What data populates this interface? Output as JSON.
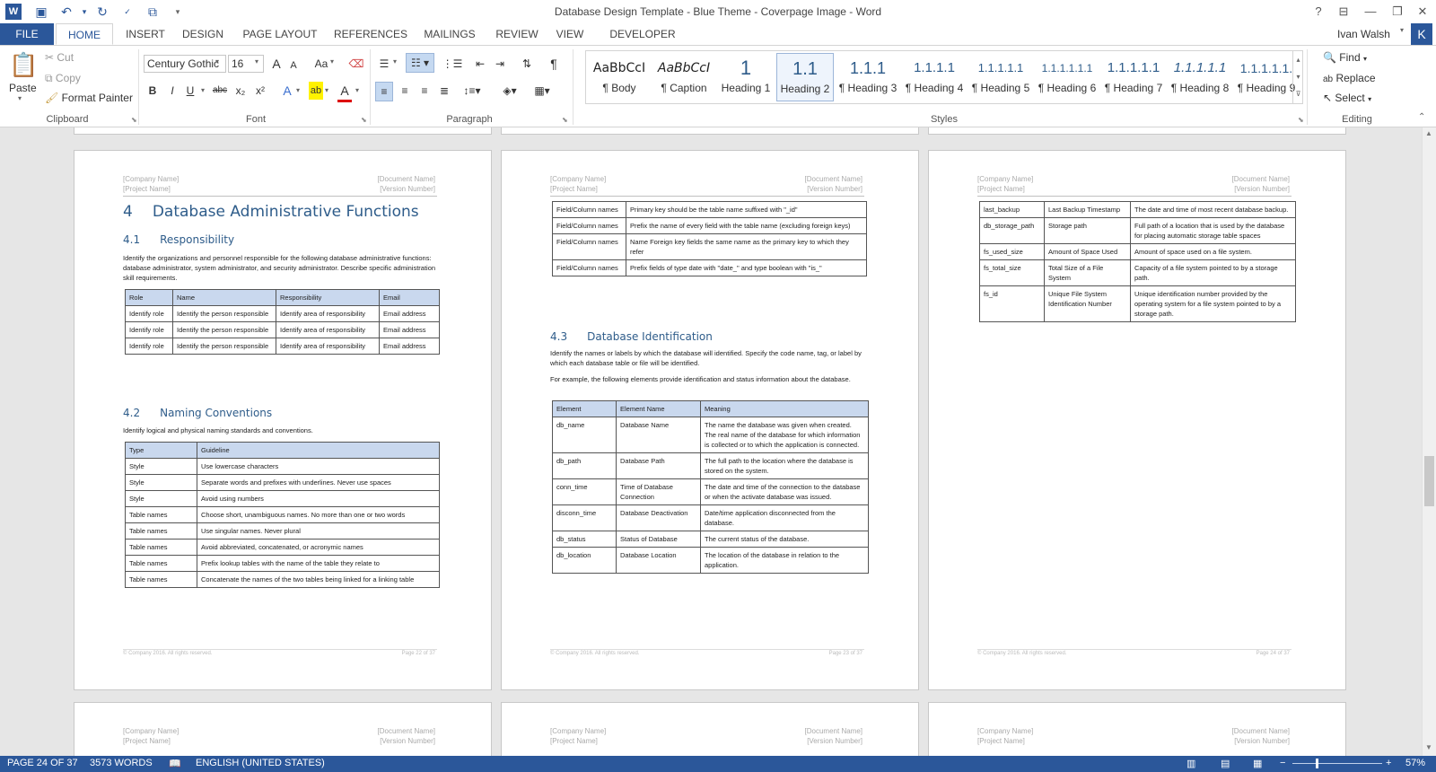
{
  "window": {
    "title": "Database Design Template - Blue Theme - Coverpage Image - Word",
    "help": "?"
  },
  "tabs": [
    "FILE",
    "HOME",
    "INSERT",
    "DESIGN",
    "PAGE LAYOUT",
    "REFERENCES",
    "MAILINGS",
    "REVIEW",
    "VIEW",
    "DEVELOPER"
  ],
  "user": {
    "name": "Ivan Walsh",
    "initial": "K"
  },
  "ribbon": {
    "clipboard": {
      "label": "Clipboard",
      "paste": "Paste",
      "cut": "Cut",
      "copy": "Copy",
      "format_painter": "Format Painter"
    },
    "font": {
      "label": "Font",
      "family": "Century Gothic",
      "size": "16",
      "bold": "B",
      "italic": "I",
      "underline": "U",
      "strike": "abc",
      "sub": "x₂",
      "sup": "x²",
      "case": "Aa",
      "grow": "A",
      "shrink": "A"
    },
    "paragraph": {
      "label": "Paragraph",
      "pilcrow": "¶"
    },
    "styles": {
      "label": "Styles",
      "items": [
        {
          "preview": "AaBbCcI",
          "name": "¶ Body"
        },
        {
          "preview": "AaBbCcI",
          "name": "¶ Caption"
        },
        {
          "preview": "1",
          "name": "Heading 1"
        },
        {
          "preview": "1.1",
          "name": "Heading 2"
        },
        {
          "preview": "1.1.1",
          "name": "¶ Heading 3"
        },
        {
          "preview": "1.1.1.1",
          "name": "¶ Heading 4"
        },
        {
          "preview": "1.1.1.1.1",
          "name": "¶ Heading 5"
        },
        {
          "preview": "1.1.1.1.1.1",
          "name": "¶ Heading 6"
        },
        {
          "preview": "1.1.1.1.1",
          "name": "¶ Heading 7"
        },
        {
          "preview": "1.1.1.1.1",
          "name": "¶ Heading 8"
        },
        {
          "preview": "1.1.1.1.1.",
          "name": "¶ Heading 9"
        }
      ]
    },
    "editing": {
      "label": "Editing",
      "find": "Find",
      "replace": "Replace",
      "select": "Select"
    }
  },
  "header": {
    "company": "[Company Name]",
    "document": "[Document Name]",
    "project": "[Project Name]",
    "version": "[Version Number]"
  },
  "page1": {
    "h1_num": "4",
    "h1": "Database Administrative Functions",
    "s41_num": "4.1",
    "s41": "Responsibility",
    "s41_body": "Identify the organizations and personnel responsible for the following database administrative functions: database administrator, system administrator, and security administrator.  Describe specific administration skill requirements.",
    "resp_cols": [
      "Role",
      "Name",
      "Responsibility",
      "Email"
    ],
    "resp_rows": [
      [
        "Identify role",
        "Identify the person responsible",
        "Identify area of responsibility",
        "Email address"
      ],
      [
        "Identify role",
        "Identify the person responsible",
        "Identify area of responsibility",
        "Email address"
      ],
      [
        "Identify role",
        "Identify the person responsible",
        "Identify area of responsibility",
        "Email address"
      ]
    ],
    "s42_num": "4.2",
    "s42": "Naming Conventions",
    "s42_body": "Identify logical and physical naming standards and conventions.",
    "naming_cols": [
      "Type",
      "Guideline"
    ],
    "naming_rows": [
      [
        "Style",
        "Use lowercase characters"
      ],
      [
        "Style",
        "Separate words and prefixes with underlines. Never use spaces"
      ],
      [
        "Style",
        "Avoid using numbers"
      ],
      [
        "Table names",
        "Choose short, unambiguous names. No more than one or two words"
      ],
      [
        "Table names",
        "Use singular names. Never plural"
      ],
      [
        "Table names",
        "Avoid abbreviated, concatenated, or acronymic names"
      ],
      [
        "Table names",
        "Prefix lookup tables with the name of the table they relate to"
      ],
      [
        "Table names",
        "Concatenate the names of the two tables being linked for a linking table"
      ]
    ],
    "footer_left": "© Company 2016. All rights reserved.",
    "footer_right": "Page 22 of 37"
  },
  "page2": {
    "field_rows": [
      [
        "Field/Column names",
        "Primary key should be the table name suffixed with \"_id\""
      ],
      [
        "Field/Column names",
        "Prefix the name of every field with the table name (excluding foreign keys)"
      ],
      [
        "Field/Column names",
        "Name Foreign key fields the same name as the primary key to which they refer"
      ],
      [
        "Field/Column names",
        "Prefix fields of type date with \"date_\" and type boolean with \"is_\""
      ]
    ],
    "s43_num": "4.3",
    "s43": "Database Identification",
    "s43_body1": "Identify the names or labels by which the database will identified. Specify the code name, tag, or label by which each database table or file will be identified.",
    "s43_body2": "For example, the following elements provide identification and status information about the database.",
    "elem_cols": [
      "Element",
      "Element Name",
      "Meaning"
    ],
    "elem_rows": [
      [
        "db_name",
        "Database Name",
        "The name the database was given when created. The real name of the database for which information is collected or to which the application is connected."
      ],
      [
        "db_path",
        "Database Path",
        "The full path to the location where the database is stored on the system."
      ],
      [
        "conn_time",
        "Time of Database Connection",
        "The date and time of the connection to the database or when the activate database was issued."
      ],
      [
        "disconn_time",
        "Database Deactivation",
        "Date/time application disconnected from the database."
      ],
      [
        "db_status",
        "Status of Database",
        "The current status of the database."
      ],
      [
        "db_location",
        "Database Location",
        "The location of the database in relation to the application."
      ]
    ],
    "footer_left": "© Company 2016. All rights reserved.",
    "footer_right": "Page 23 of 37"
  },
  "page3": {
    "rows": [
      [
        "last_backup",
        "Last Backup Timestamp",
        "The date and time of most recent database backup."
      ],
      [
        "db_storage_path",
        "Storage path",
        "Full path of a location that is used by the database for placing automatic storage table spaces"
      ],
      [
        "fs_used_size",
        "Amount of Space Used",
        "Amount of space used on a file system."
      ],
      [
        "fs_total_size",
        "Total Size of a File System",
        "Capacity of a file system pointed to by a storage path."
      ],
      [
        "fs_id",
        "Unique File System Identification Number",
        "Unique identification number provided by the operating system for a file system pointed to by a storage path."
      ]
    ],
    "footer_left": "© Company 2016. All rights reserved.",
    "footer_right": "Page 24 of 37"
  },
  "status": {
    "page": "PAGE 24 OF 37",
    "words": "3573 WORDS",
    "language": "ENGLISH (UNITED STATES)",
    "zoom": "57%",
    "zoom_minus": "−",
    "zoom_plus": "+"
  }
}
